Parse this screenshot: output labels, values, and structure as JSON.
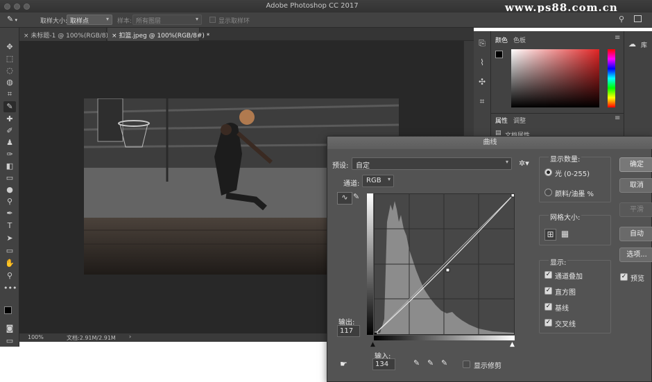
{
  "app": {
    "title": "Adobe Photoshop CC 2017",
    "watermark": "www.ps88.com.cn"
  },
  "options_bar": {
    "sample_size_label": "取样大小:",
    "sample_size_value": "取样点",
    "sample_label": "样本:",
    "sample_value": "所有图层",
    "show_ring_label": "显示取样环"
  },
  "tabs": [
    {
      "label": "未标题-1 @ 100%(RGB/8) *",
      "active": false
    },
    {
      "label": "扣篮.jpeg @ 100%(RGB/8#) *",
      "active": true
    }
  ],
  "status": {
    "zoom": "100%",
    "doc": "文档:2.91M/2.91M"
  },
  "color_panel": {
    "tabs": [
      "颜色",
      "色板"
    ]
  },
  "properties_panel": {
    "tabs": [
      "属性",
      "调整"
    ],
    "item": "文档属性"
  },
  "library_panel": {
    "label": "库"
  },
  "curves": {
    "title": "曲线",
    "preset_label": "预设:",
    "preset_value": "自定",
    "channel_label": "通道:",
    "channel_value": "RGB",
    "output_label": "输出:",
    "output_value": "117",
    "input_label": "输入:",
    "input_value": "134",
    "show_clipping_label": "显示修剪",
    "buttons": {
      "ok": "确定",
      "cancel": "取消",
      "smooth": "平滑",
      "auto": "自动",
      "options": "选项..."
    },
    "preview_label": "预览",
    "show_amount_label": "显示数量:",
    "light_label": "光 (0-255)",
    "pigment_label": "颜料/油墨 %",
    "grid_size_label": "网格大小:",
    "display_label": "显示:",
    "display_options": [
      {
        "label": "通道叠加",
        "checked": true
      },
      {
        "label": "直方图",
        "checked": true
      },
      {
        "label": "基线",
        "checked": true
      },
      {
        "label": "交叉线",
        "checked": true
      }
    ],
    "preview_checked": true,
    "light_selected": true
  }
}
